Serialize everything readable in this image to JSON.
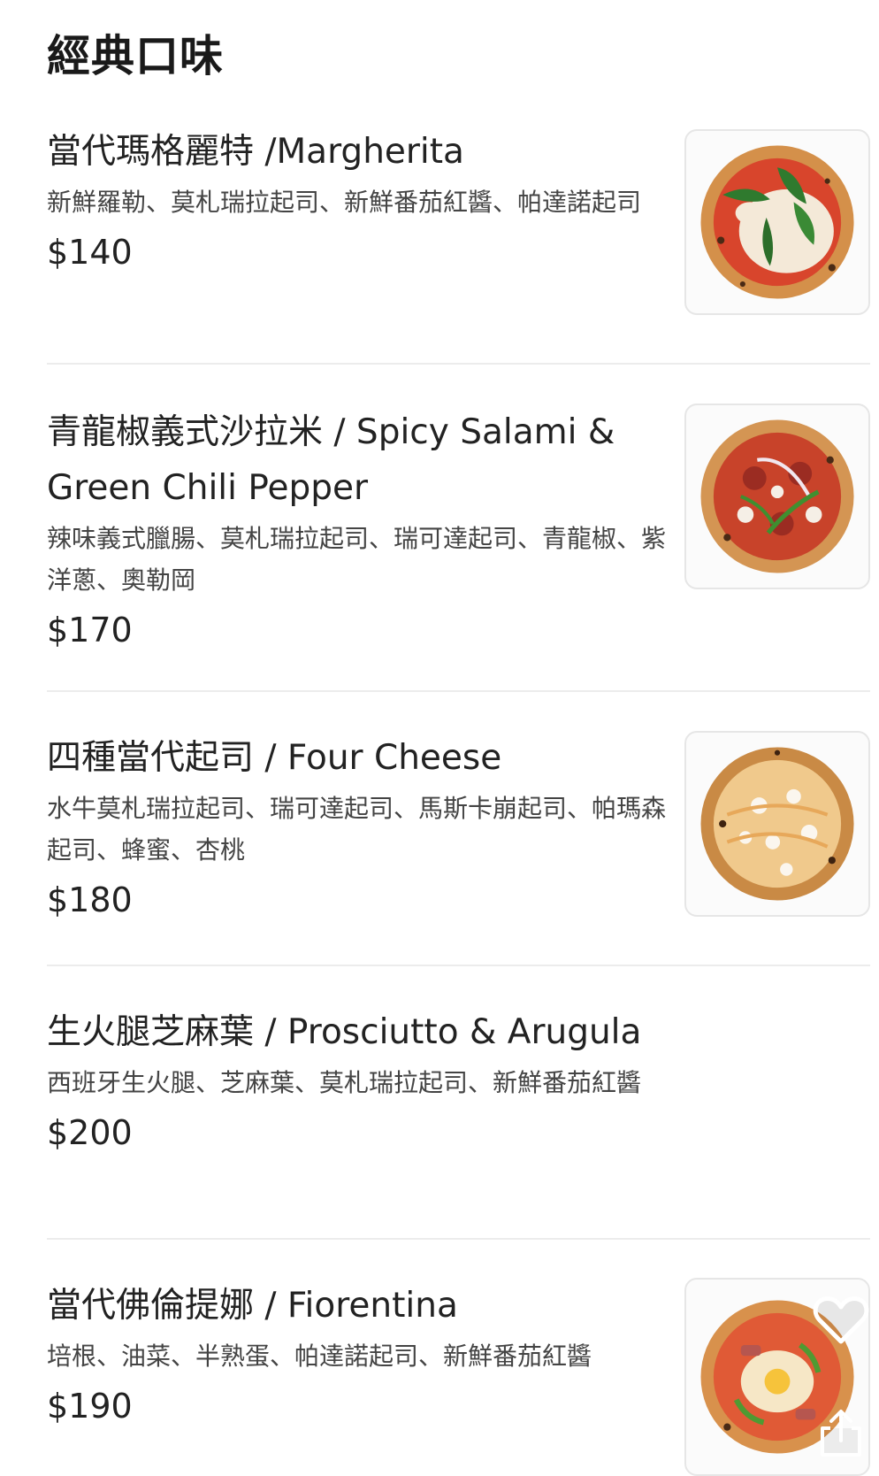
{
  "section": {
    "title": "經典口味"
  },
  "items": [
    {
      "name": "當代瑪格麗特 /Margherita",
      "description": "新鮮羅勒、莫札瑞拉起司、新鮮番茄紅醬、帕達諾起司",
      "price": "$140",
      "image": "margherita-pizza"
    },
    {
      "name": "青龍椒義式沙拉米 / Spicy Salami & Green Chili Pepper",
      "description": "辣味義式臘腸、莫札瑞拉起司、瑞可達起司、青龍椒、紫洋蔥、奧勒岡",
      "price": "$170",
      "image": "spicy-salami-pizza"
    },
    {
      "name": "四種當代起司 / Four Cheese",
      "description": "水牛莫札瑞拉起司、瑞可達起司、馬斯卡崩起司、帕瑪森起司、蜂蜜、杏桃",
      "price": "$180",
      "image": "four-cheese-pizza"
    },
    {
      "name": "生火腿芝麻葉 / Prosciutto & Arugula",
      "description": "西班牙生火腿、芝麻葉、莫札瑞拉起司、新鮮番茄紅醬",
      "price": "$200"
    },
    {
      "name": "當代佛倫提娜 / Fiorentina",
      "description": "培根、油菜、半熟蛋、帕達諾起司、新鮮番茄紅醬",
      "price": "$190",
      "image": "fiorentina-pizza"
    }
  ],
  "icons": {
    "favorite": "heart-icon",
    "share": "share-icon"
  },
  "colors": {
    "background": "#ffffff",
    "divider": "#ececec",
    "text": "#222222",
    "description": "#444444"
  }
}
